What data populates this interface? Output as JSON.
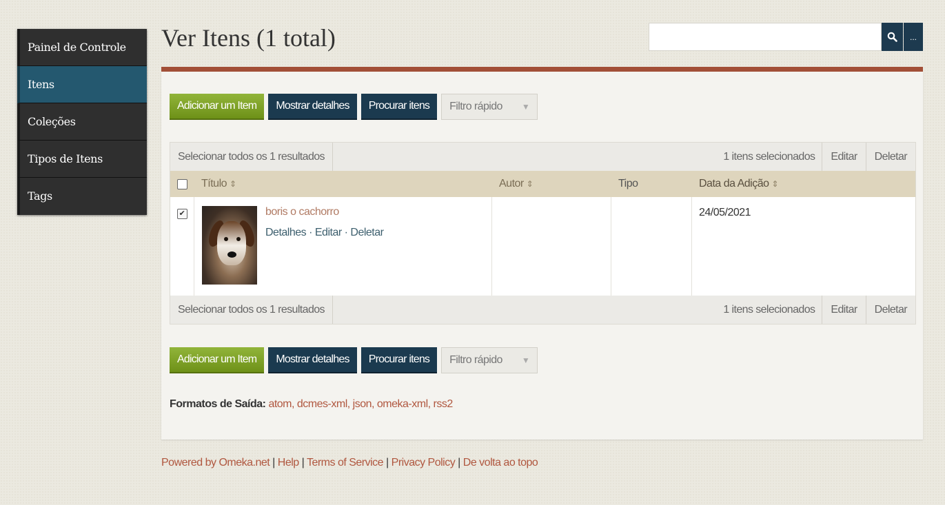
{
  "sidebar": {
    "items": [
      {
        "label": "Painel de Controle"
      },
      {
        "label": "Itens"
      },
      {
        "label": "Coleções"
      },
      {
        "label": "Tipos de Itens"
      },
      {
        "label": "Tags"
      }
    ],
    "active_index": 1
  },
  "header": {
    "title": "Ver Itens (1 total)",
    "search_placeholder": "",
    "search_button_icon": "search-icon",
    "search_more_label": "..."
  },
  "toolbar": {
    "add_item": "Adicionar um Item",
    "show_details": "Mostrar detalhes",
    "search_items": "Procurar itens",
    "quick_filter": "Filtro rápido"
  },
  "batch": {
    "select_all": "Selecionar todos os 1 resultados",
    "selected_count": "1 itens selecionados",
    "edit": "Editar",
    "delete": "Deletar"
  },
  "table": {
    "columns": {
      "title": "Título",
      "author": "Autor",
      "type": "Tipo",
      "date_added": "Data da Adição"
    },
    "rows": [
      {
        "checked": true,
        "title": "boris o cachorro",
        "actions": {
          "details": "Detalhes",
          "edit": "Editar",
          "delete": "Deletar",
          "separator": " · "
        },
        "author": "",
        "type": "",
        "date_added": "24/05/2021"
      }
    ]
  },
  "formats": {
    "label": "Formatos de Saída:",
    "items": [
      "atom",
      "dcmes-xml",
      "json",
      "omeka-xml",
      "rss2"
    ]
  },
  "footer": {
    "links": [
      "Powered by Omeka.net",
      "Help",
      "Terms of Service",
      "Privacy Policy",
      "De volta ao topo"
    ]
  },
  "colors": {
    "accent_rule": "#a24f37",
    "sidebar_active": "#24586f",
    "button_green": "#7fa224",
    "button_dark": "#1b3a4f",
    "table_header": "#ded5bd",
    "link": "#b0573f"
  }
}
